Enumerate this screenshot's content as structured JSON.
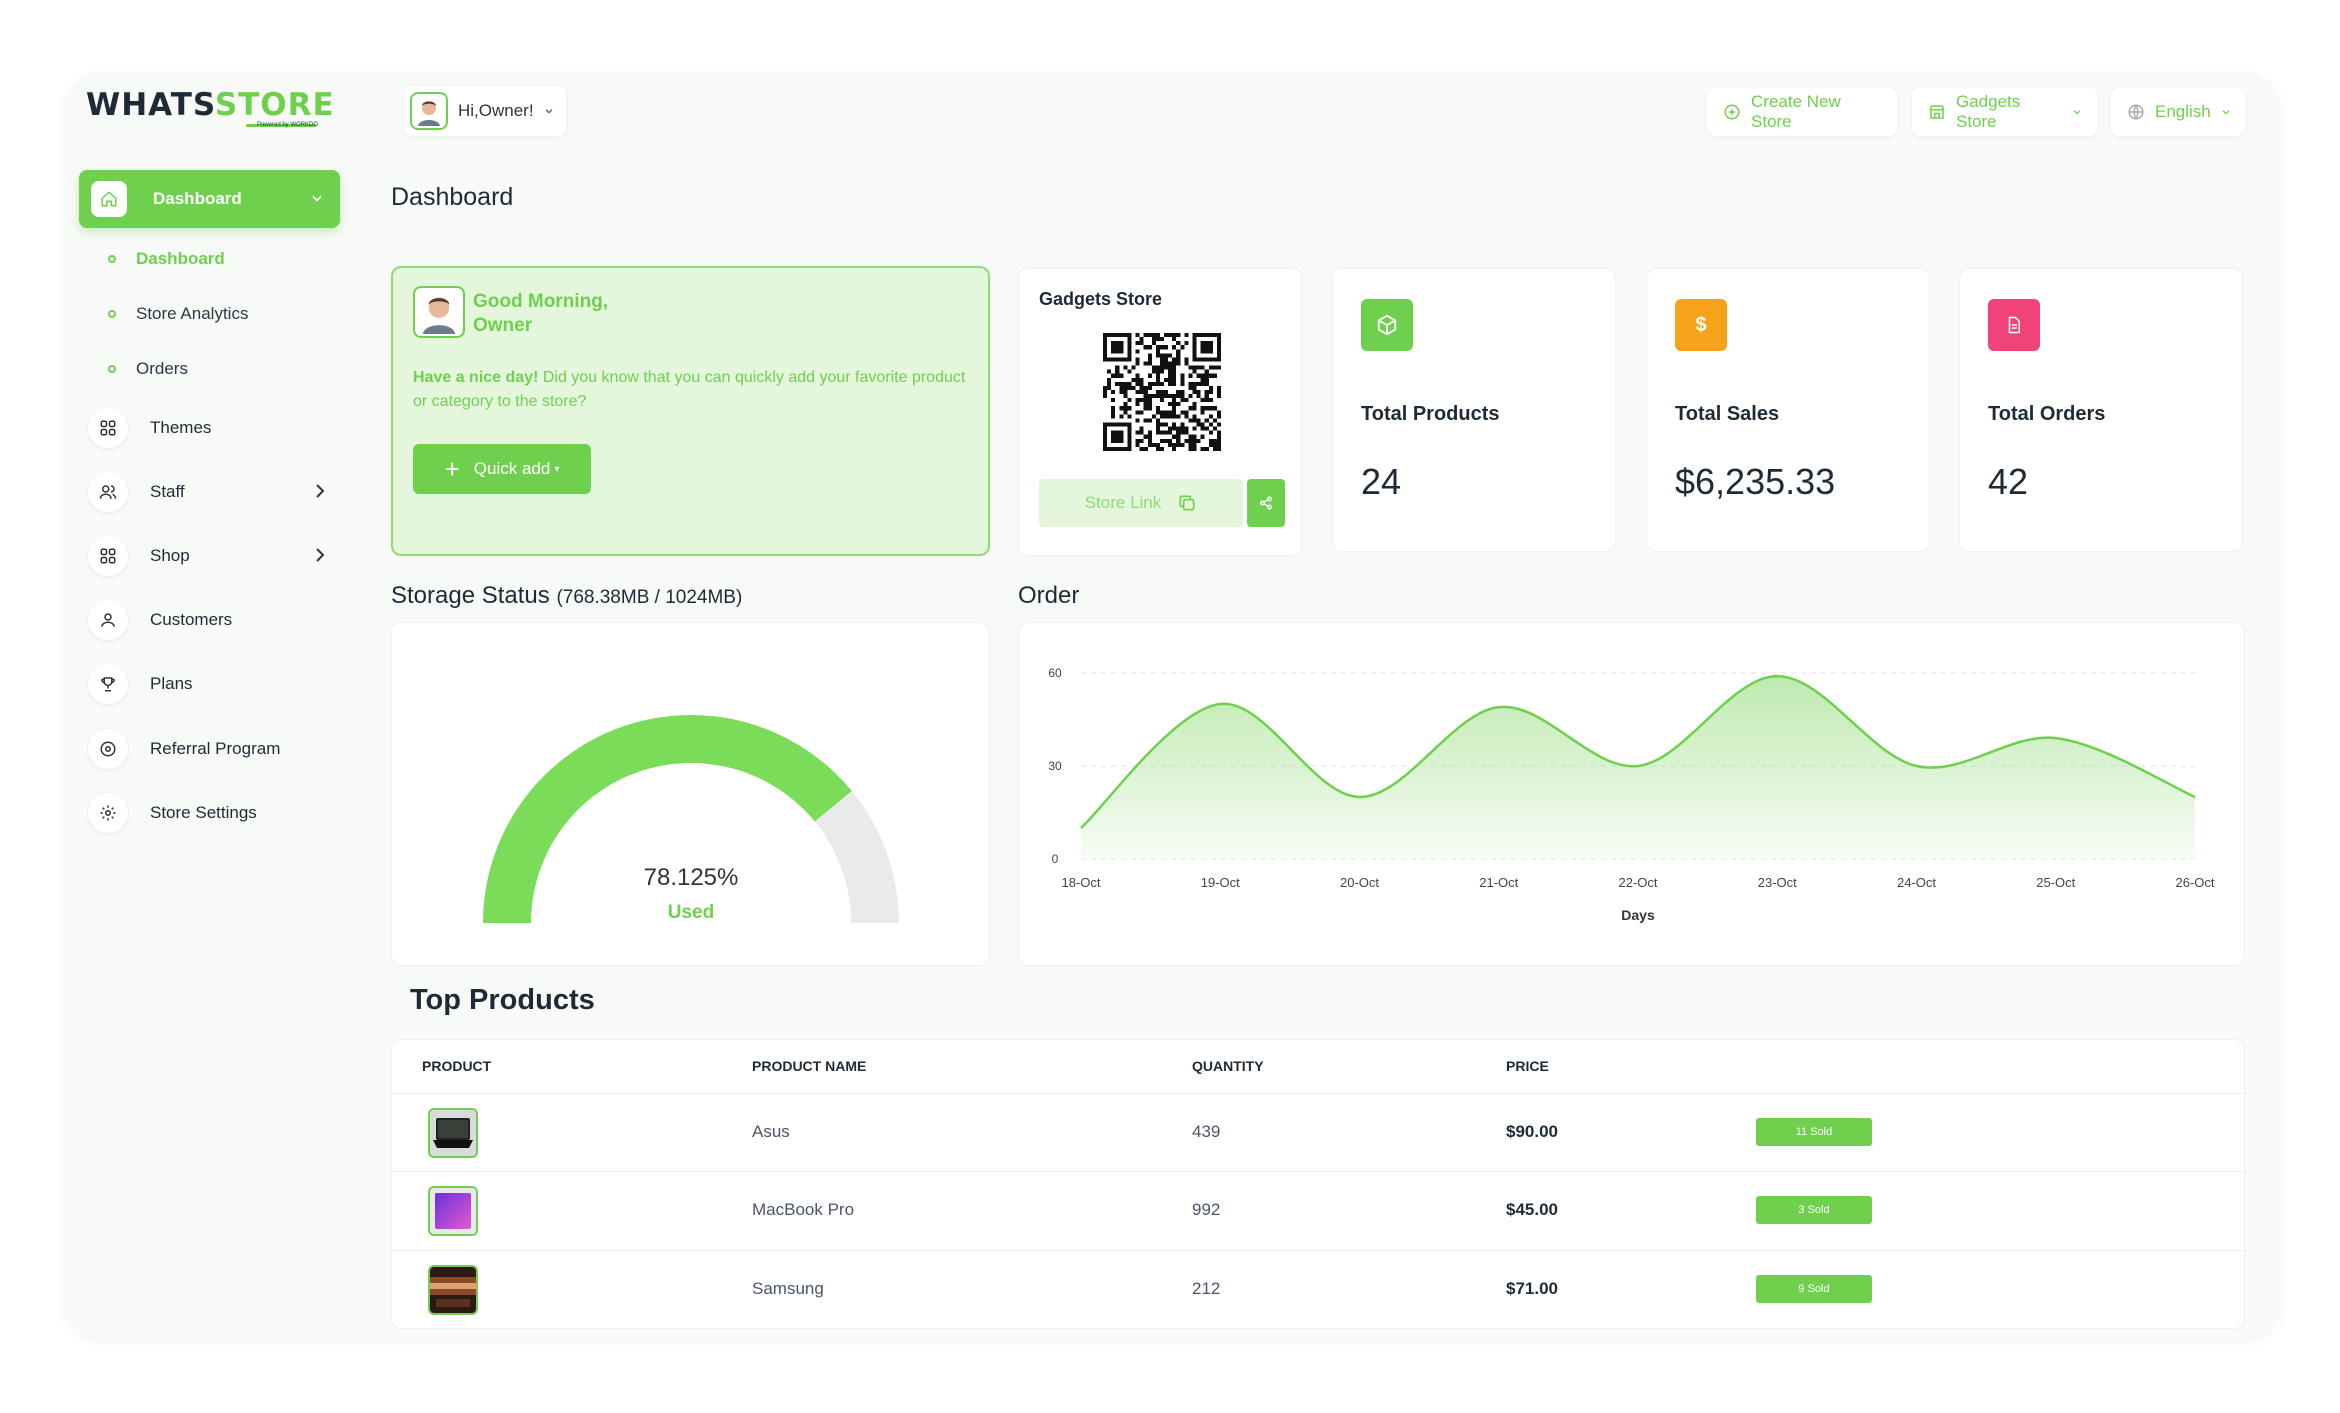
{
  "brand": {
    "name_part1": "WHATS",
    "name_part2": "STORE",
    "tagline": "Powered by WORKDO"
  },
  "user": {
    "greeting": "Hi,Owner!"
  },
  "topbar": {
    "create_store": "Create New Store",
    "store_select": "Gadgets Store",
    "language": "English"
  },
  "sidebar": {
    "main": "Dashboard",
    "subitems": [
      "Dashboard",
      "Store Analytics",
      "Orders"
    ],
    "items": [
      {
        "label": "Themes",
        "icon": "grid-icon"
      },
      {
        "label": "Staff",
        "icon": "users-icon"
      },
      {
        "label": "Shop",
        "icon": "grid-icon"
      },
      {
        "label": "Customers",
        "icon": "user-icon"
      },
      {
        "label": "Plans",
        "icon": "trophy-icon"
      },
      {
        "label": "Referral Program",
        "icon": "referral-icon"
      },
      {
        "label": "Store Settings",
        "icon": "gear-icon"
      }
    ]
  },
  "page": {
    "title": "Dashboard"
  },
  "welcome": {
    "hello_line1": "Good Morning,",
    "hello_line2": "Owner",
    "msg_bold": "Have a nice day!",
    "msg_rest": " Did you know that you can quickly add your favorite product or category to the store?",
    "quick_add": "Quick add"
  },
  "store_card": {
    "name": "Gadgets Store",
    "link_label": "Store Link"
  },
  "stats": [
    {
      "label": "Total Products",
      "value": "24",
      "color": "#6fd04e",
      "icon": "box-icon"
    },
    {
      "label": "Total Sales",
      "value": "$6,235.33",
      "color": "#f7a21b",
      "icon": "dollar-icon"
    },
    {
      "label": "Total Orders",
      "value": "42",
      "color": "#f0437a",
      "icon": "document-icon"
    }
  ],
  "storage": {
    "title": "Storage Status",
    "detail": "(768.38MB / 1024MB)",
    "percent_text": "78.125%",
    "percent": 78.125,
    "used_label": "Used"
  },
  "order_section": {
    "title": "Order"
  },
  "chart_data": {
    "type": "area",
    "categories": [
      "18-Oct",
      "19-Oct",
      "20-Oct",
      "21-Oct",
      "22-Oct",
      "23-Oct",
      "24-Oct",
      "25-Oct",
      "26-Oct"
    ],
    "series": [
      {
        "values": [
          10,
          50,
          20,
          49,
          30,
          59,
          30,
          39,
          20
        ]
      }
    ],
    "xlabel": "Days",
    "ylabel": "",
    "ylim": [
      0,
      60
    ],
    "yticks": [
      "0",
      "30",
      "60"
    ],
    "grid": true,
    "color": "#6fd04e"
  },
  "top_products": {
    "title": "Top Products",
    "headers": [
      "PRODUCT",
      "PRODUCT NAME",
      "QUANTITY",
      "PRICE"
    ],
    "rows": [
      {
        "name": "Asus",
        "quantity": "439",
        "price": "$90.00",
        "sold": "11 Sold",
        "thumb": "laptop-dark"
      },
      {
        "name": "MacBook Pro",
        "quantity": "992",
        "price": "$45.00",
        "sold": "3 Sold",
        "thumb": "laptop-purple"
      },
      {
        "name": "Samsung",
        "quantity": "212",
        "price": "$71.00",
        "sold": "9 Sold",
        "thumb": "phone-warm"
      }
    ]
  },
  "colors": {
    "accent": "#6fd04e",
    "accent_light": "#e4f6dc"
  }
}
